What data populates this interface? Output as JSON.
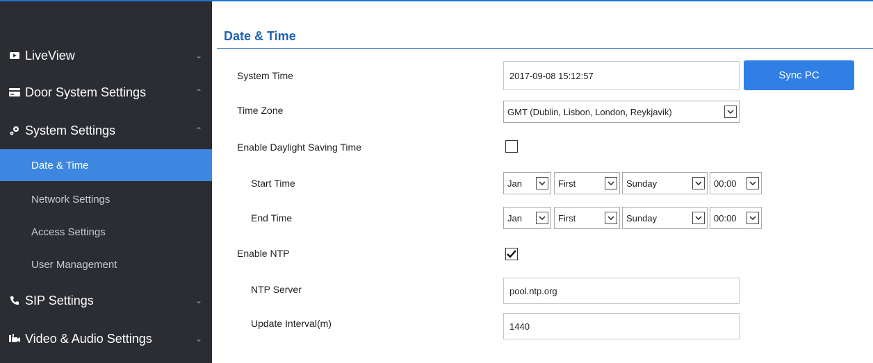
{
  "sidebar": {
    "liveview": "LiveView",
    "door_system": "Door System Settings",
    "system_settings": "System Settings",
    "sub_items": [
      "Date & Time",
      "Network Settings",
      "Access Settings",
      "User Management"
    ],
    "sip": "SIP Settings",
    "video_audio": "Video & Audio Settings"
  },
  "page": {
    "title": "Date & Time"
  },
  "form": {
    "system_time_label": "System Time",
    "system_time_value": "2017-09-08 15:12:57",
    "sync_button": "Sync PC",
    "time_zone_label": "Time Zone",
    "time_zone_value": "GMT (Dublin, Lisbon, London, Reykjavik)",
    "dst_label": "Enable Daylight Saving Time",
    "dst_checked": false,
    "start_label": "Start Time",
    "start": {
      "month": "Jan",
      "week": "First",
      "day": "Sunday",
      "time": "00:00"
    },
    "end_label": "End Time",
    "end": {
      "month": "Jan",
      "week": "First",
      "day": "Sunday",
      "time": "00:00"
    },
    "ntp_label": "Enable NTP",
    "ntp_checked": true,
    "ntp_server_label": "NTP Server",
    "ntp_server_value": "pool.ntp.org",
    "interval_label": "Update Interval(m)",
    "interval_value": "1440"
  },
  "colors": {
    "accent": "#2f7fe5",
    "sidebar_bg": "#2b2d33",
    "active": "#3d87e0",
    "title": "#1f62b7"
  },
  "icons": [
    "video-icon",
    "card-icon",
    "gear-icon",
    "phone-icon",
    "av-icon",
    "chevron-down-icon",
    "chevron-up-icon",
    "checkmark-icon"
  ]
}
